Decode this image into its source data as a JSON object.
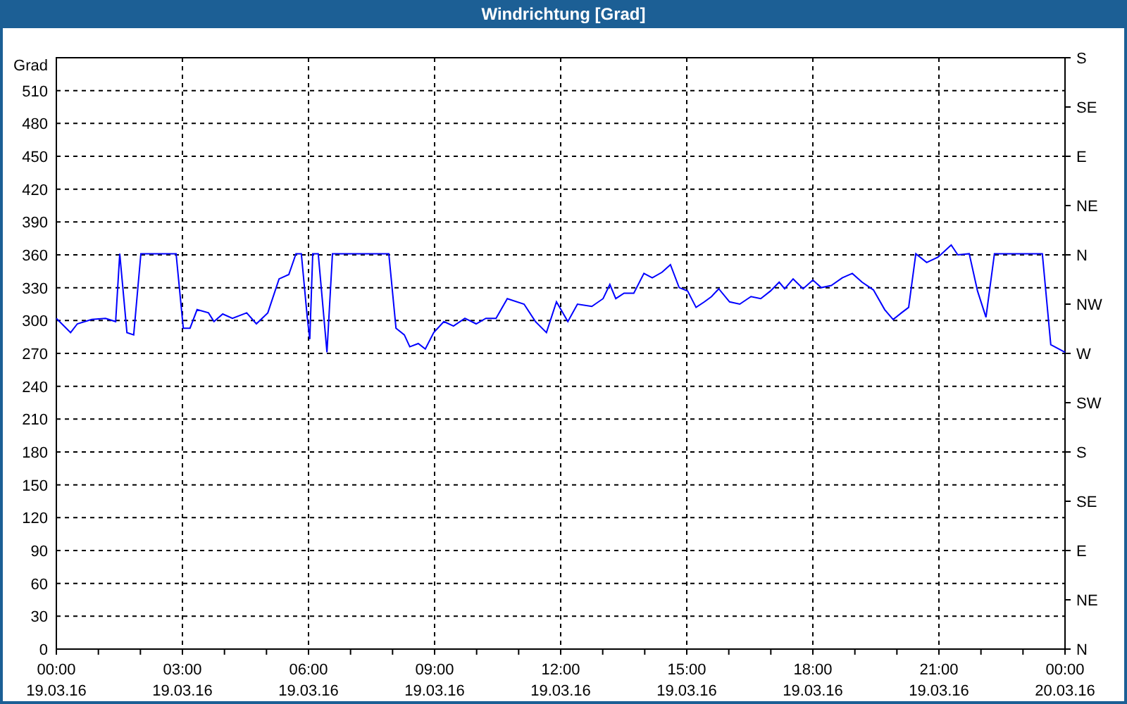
{
  "chart": {
    "chart_data": {
      "type": "line",
      "title": "Windrichtung [Grad]",
      "ylabel": "Grad",
      "grid": true,
      "xlim": [
        0,
        24
      ],
      "ylim": [
        0,
        540
      ],
      "x": [
        0,
        0.34,
        0.5,
        0.84,
        1.17,
        1.41,
        1.51,
        1.68,
        1.84,
        2.01,
        2.85,
        3.02,
        3.18,
        3.35,
        3.62,
        3.75,
        3.96,
        4.19,
        4.53,
        4.76,
        5.03,
        5.3,
        5.53,
        5.7,
        5.83,
        5.97,
        6.03,
        6.1,
        6.23,
        6.44,
        6.57,
        7.91,
        8.08,
        8.28,
        8.41,
        8.61,
        8.78,
        8.98,
        9.22,
        9.45,
        9.72,
        9.99,
        10.22,
        10.46,
        10.73,
        11.13,
        11.4,
        11.66,
        11.9,
        12.17,
        12.4,
        12.74,
        13.01,
        13.17,
        13.31,
        13.51,
        13.74,
        13.98,
        14.18,
        14.41,
        14.61,
        14.82,
        15.02,
        15.22,
        15.42,
        15.59,
        15.76,
        16.02,
        16.26,
        16.53,
        16.76,
        16.99,
        17.2,
        17.33,
        17.53,
        17.77,
        18,
        18.2,
        18.44,
        18.7,
        18.94,
        19.17,
        19.44,
        19.71,
        19.91,
        20.11,
        20.28,
        20.45,
        20.71,
        20.98,
        21.29,
        21.45,
        21.72,
        21.92,
        22.12,
        22.32,
        23.46,
        23.66,
        24
      ],
      "series": [
        {
          "color": "#0000ff",
          "values": [
            302,
            289,
            297,
            301,
            302,
            299,
            361,
            289,
            287,
            361,
            361,
            293,
            293,
            310,
            307,
            299,
            306,
            302,
            307,
            297,
            307,
            338,
            342,
            361,
            361,
            303,
            283,
            361,
            361,
            271,
            361,
            361,
            293,
            287,
            276,
            279,
            274,
            289,
            299,
            295,
            302,
            297,
            302,
            302,
            320,
            315,
            299,
            289,
            317,
            299,
            315,
            313,
            320,
            333,
            320,
            325,
            325,
            343,
            339,
            344,
            351,
            330,
            327,
            312,
            317,
            322,
            329,
            317,
            315,
            322,
            320,
            327,
            335,
            329,
            338,
            329,
            337,
            330,
            332,
            339,
            343,
            335,
            328,
            310,
            301,
            307,
            312,
            361,
            353,
            358,
            369,
            360,
            361,
            327,
            303,
            361,
            361,
            278,
            271
          ]
        }
      ],
      "xticks": [
        {
          "value": 0,
          "label": "00:00"
        },
        {
          "value": 3,
          "label": "03:00"
        },
        {
          "value": 6,
          "label": "06:00"
        },
        {
          "value": 9,
          "label": "09:00"
        },
        {
          "value": 12,
          "label": "12:00"
        },
        {
          "value": 15,
          "label": "15:00"
        },
        {
          "value": 18,
          "label": "18:00"
        },
        {
          "value": 21,
          "label": "21:00"
        },
        {
          "value": 24,
          "label": "00:00"
        }
      ],
      "yticks": [
        0,
        30,
        60,
        90,
        120,
        150,
        180,
        210,
        240,
        270,
        300,
        330,
        360,
        390,
        420,
        450,
        480,
        510
      ]
    },
    "x_dates": [
      "19.03.16",
      "19.03.16",
      "19.03.16",
      "19.03.16",
      "19.03.16",
      "19.03.16",
      "19.03.16",
      "19.03.16",
      "20.03.16"
    ],
    "secondary_axis": {
      "labels": [
        "S",
        "SE",
        "E",
        "NE",
        "N",
        "NW",
        "W",
        "SW",
        "S",
        "SE",
        "E",
        "NE",
        "N"
      ]
    }
  }
}
